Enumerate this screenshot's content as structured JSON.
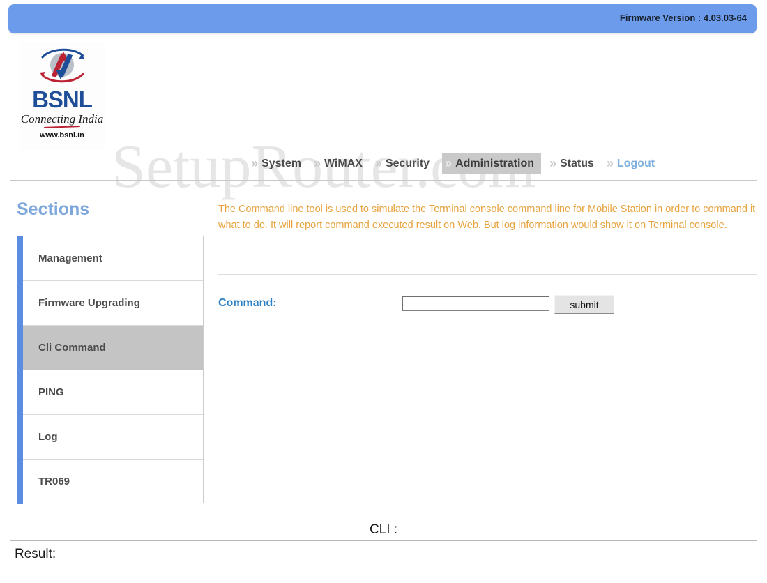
{
  "header": {
    "firmware_label": "Firmware Version : 4.03.03-64"
  },
  "logo": {
    "brand": "BSNL",
    "tagline": "Connecting India",
    "url": "www.bsnl.in",
    "icon": "bsnl-globe-arrow-logo"
  },
  "watermark": {
    "text": "SetupRouter.com"
  },
  "nav": {
    "chevron": "»",
    "items": [
      {
        "label": "System",
        "active": false,
        "accent": false
      },
      {
        "label": "WiMAX",
        "active": false,
        "accent": false
      },
      {
        "label": "Security",
        "active": false,
        "accent": false
      },
      {
        "label": "Administration",
        "active": true,
        "accent": false
      },
      {
        "label": "Status",
        "active": false,
        "accent": false
      },
      {
        "label": "Logout",
        "active": false,
        "accent": true
      }
    ]
  },
  "sidebar": {
    "title": "Sections",
    "items": [
      {
        "label": "Management",
        "active": false
      },
      {
        "label": "Firmware Upgrading",
        "active": false
      },
      {
        "label": "Cli Command",
        "active": true
      },
      {
        "label": "PING",
        "active": false
      },
      {
        "label": "Log",
        "active": false
      },
      {
        "label": "TR069",
        "active": false
      }
    ]
  },
  "main": {
    "description": "The Command line tool is used to simulate the Terminal console command line for Mobile Station in order to command it what to do. It will report command executed result on Web. But log information would show it on Terminal console.",
    "command_label": "Command:",
    "command_value": "",
    "command_placeholder": "",
    "submit_label": "submit"
  },
  "output": {
    "cli_label": "CLI :",
    "result_label": "Result:"
  },
  "colors": {
    "header_blue": "#6c9bec",
    "accent_blue": "#5b8ee0",
    "section_title_blue": "#7ea8dd",
    "command_label_blue": "#2b7fc4",
    "logout_blue": "#7fb0e0",
    "description_orange": "#e8a33d",
    "active_gray": "#c4c4c4",
    "brand_navy": "#1f4e99",
    "brand_red": "#bb2233"
  }
}
